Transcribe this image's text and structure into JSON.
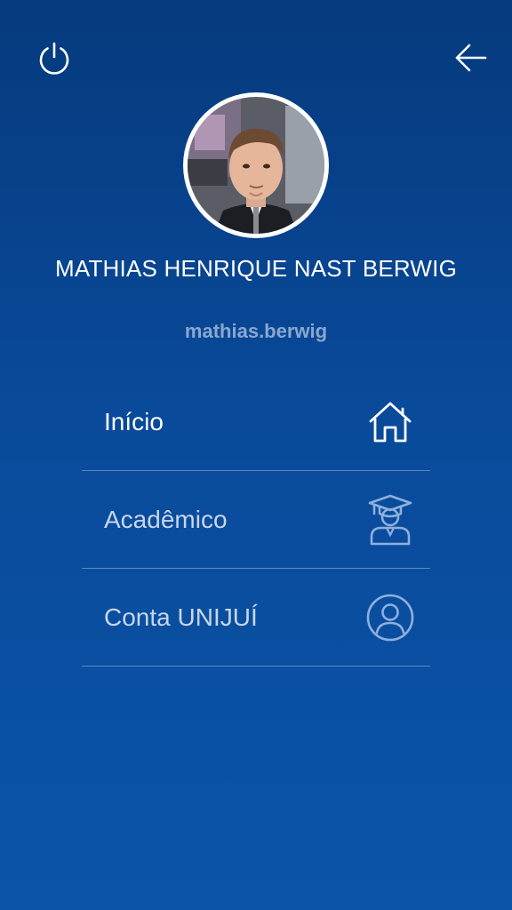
{
  "header": {
    "power_icon": "power-icon",
    "back_icon": "arrow-left-icon"
  },
  "profile": {
    "name": "MATHIAS HENRIQUE NAST BERWIG",
    "login": "mathias.berwig"
  },
  "menu": {
    "items": [
      {
        "label": "Início",
        "icon": "home-icon"
      },
      {
        "label": "Acadêmico",
        "icon": "graduate-icon"
      },
      {
        "label": "Conta UNIJUÍ",
        "icon": "account-circle-icon"
      }
    ]
  },
  "colors": {
    "background_top": "#063a7d",
    "background_bottom": "#0b54a8",
    "login_text": "#8aa7cf",
    "divider": "#a0b9dc",
    "dim_icon": "#8fb0dc"
  }
}
